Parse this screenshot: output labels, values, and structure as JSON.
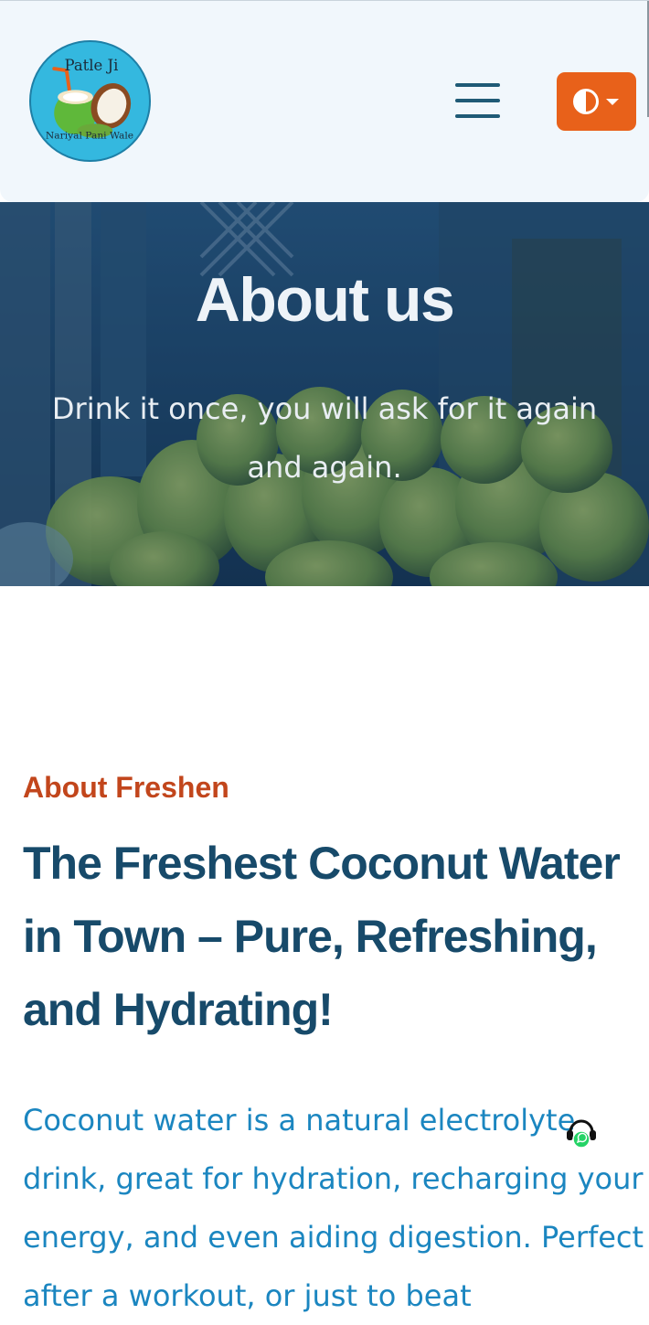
{
  "header": {
    "logo": {
      "line1": "Patle Ji",
      "line2": "Nariyal Pani Wale"
    },
    "menu_icon": "hamburger-menu-icon",
    "theme_toggle_icon": "contrast-half-circle-icon",
    "theme_toggle_caret": "caret-down-icon",
    "accent_color": "#e8611a"
  },
  "hero": {
    "title": "About us",
    "subtitle": "Drink it once, you will ask for it again and again."
  },
  "about": {
    "eyebrow": "About Freshen",
    "heading": "The Freshest Coconut Water in Town – Pure, Refreshing, and Hydrating!",
    "body": "Coconut water is a natural electrolyte drink, great for hydration, recharging your energy, and even aiding digestion. Perfect after a workout, or just to beat"
  },
  "floating": {
    "support_icon": "headset-whatsapp-icon"
  },
  "colors": {
    "eyebrow": "#c2461c",
    "heading": "#174a6a",
    "body": "#1b86c0",
    "header_bg": "#f1f7fc"
  }
}
